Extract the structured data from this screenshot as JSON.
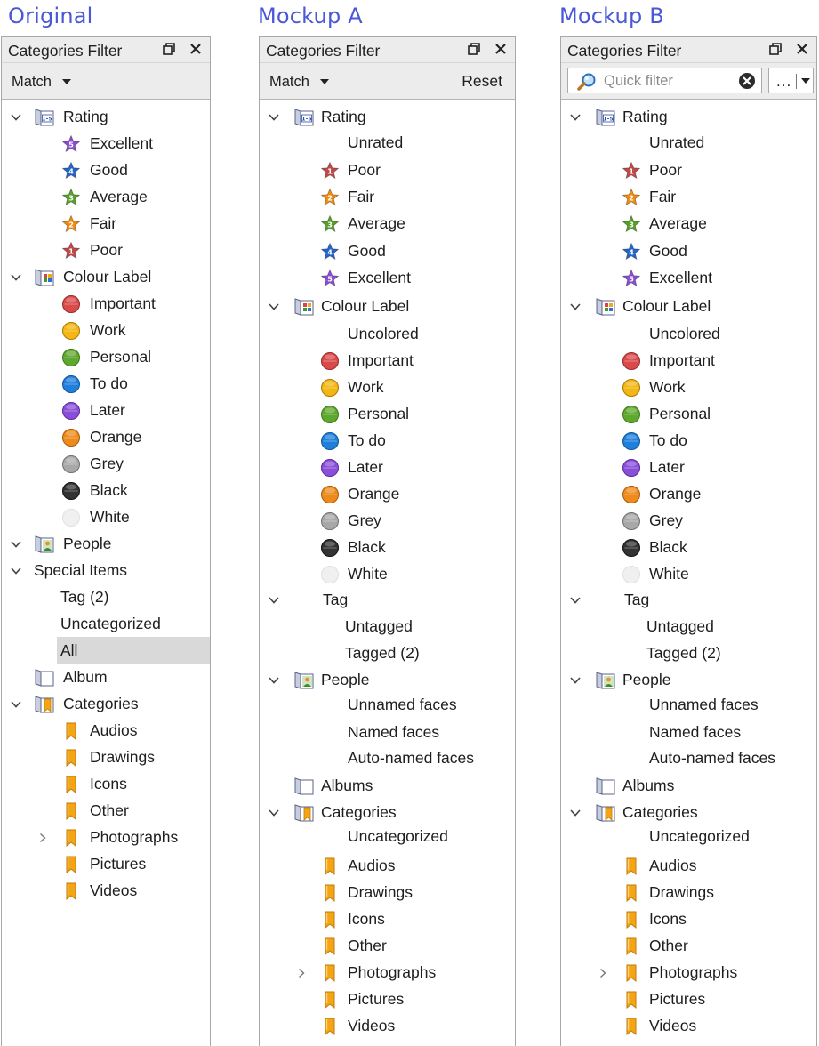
{
  "columns": {
    "original": "Original",
    "mockup_a": "Mockup A",
    "mockup_b": "Mockup B"
  },
  "panel": {
    "title": "Categories Filter",
    "match_label": "Match",
    "reset_label": "Reset",
    "quick_filter_placeholder": "Quick filter",
    "more_label": "..."
  },
  "colors": {
    "title_blue": "#4a57d6",
    "panel_border": "#a8a8a8",
    "toolbar_bg": "#ececec",
    "selection_bg": "#d9d9d9",
    "star_excellent": "#8a4fd0",
    "star_good": "#2466c8",
    "star_average": "#57a12a",
    "star_fair": "#f08c10",
    "star_poor": "#c04a4a",
    "label_important": "#d94a4a",
    "label_work": "#f3b612",
    "label_personal": "#5fa82e",
    "label_todo": "#1f7fdb",
    "label_later": "#8a4fd8",
    "label_orange": "#ee8a1c",
    "label_grey": "#a8a8a8",
    "label_black": "#333333",
    "label_white": "#f0f0f0"
  },
  "original": {
    "tree": [
      {
        "depth": 0,
        "exp": "down",
        "icon": "rating-icon",
        "label": "Rating"
      },
      {
        "depth": 1,
        "icon": "star-excellent-icon",
        "label": "Excellent"
      },
      {
        "depth": 1,
        "icon": "star-good-icon",
        "label": "Good"
      },
      {
        "depth": 1,
        "icon": "star-average-icon",
        "label": "Average"
      },
      {
        "depth": 1,
        "icon": "star-fair-icon",
        "label": "Fair"
      },
      {
        "depth": 1,
        "icon": "star-poor-icon",
        "label": "Poor"
      },
      {
        "depth": 0,
        "exp": "down",
        "icon": "colour-label-icon",
        "label": "Colour Label"
      },
      {
        "depth": 1,
        "icon": "label-important-icon",
        "label": "Important"
      },
      {
        "depth": 1,
        "icon": "label-work-icon",
        "label": "Work"
      },
      {
        "depth": 1,
        "icon": "label-personal-icon",
        "label": "Personal"
      },
      {
        "depth": 1,
        "icon": "label-todo-icon",
        "label": "To do"
      },
      {
        "depth": 1,
        "icon": "label-later-icon",
        "label": "Later"
      },
      {
        "depth": 1,
        "icon": "label-orange-icon",
        "label": "Orange"
      },
      {
        "depth": 1,
        "icon": "label-grey-icon",
        "label": "Grey"
      },
      {
        "depth": 1,
        "icon": "label-black-icon",
        "label": "Black"
      },
      {
        "depth": 1,
        "icon": "label-white-icon",
        "label": "White"
      },
      {
        "depth": 0,
        "exp": "down",
        "icon": "people-icon",
        "label": "People"
      },
      {
        "depth": 0,
        "exp": "down",
        "label": "Special Items"
      },
      {
        "depth": 1,
        "label": "Tag (2)"
      },
      {
        "depth": 1,
        "label": "Uncategorized"
      },
      {
        "depth": 1,
        "label": "All",
        "selected": true
      },
      {
        "depth": 0,
        "icon": "album-icon",
        "label": "Album"
      },
      {
        "depth": 0,
        "exp": "down",
        "icon": "categories-icon",
        "label": "Categories"
      },
      {
        "depth": 1,
        "icon": "bookmark-icon",
        "label": "Audios"
      },
      {
        "depth": 1,
        "icon": "bookmark-icon",
        "label": "Drawings"
      },
      {
        "depth": 1,
        "icon": "bookmark-icon",
        "label": "Icons"
      },
      {
        "depth": 1,
        "icon": "bookmark-icon",
        "label": "Other"
      },
      {
        "depth": 1,
        "exp": "right",
        "icon": "bookmark-icon",
        "label": "Photographs"
      },
      {
        "depth": 1,
        "icon": "bookmark-icon",
        "label": "Pictures"
      },
      {
        "depth": 1,
        "icon": "bookmark-icon",
        "label": "Videos"
      }
    ]
  },
  "mockup_a": {
    "tree": [
      {
        "depth": 0,
        "exp": "down",
        "icon": "rating-icon",
        "label": "Rating"
      },
      {
        "depth": 1,
        "label": "Unrated"
      },
      {
        "depth": 1,
        "icon": "star-poor-icon",
        "label": "Poor"
      },
      {
        "depth": 1,
        "icon": "star-fair-icon",
        "label": "Fair"
      },
      {
        "depth": 1,
        "icon": "star-average-icon",
        "label": "Average"
      },
      {
        "depth": 1,
        "icon": "star-good-icon",
        "label": "Good"
      },
      {
        "depth": 1,
        "icon": "star-excellent-icon",
        "label": "Excellent"
      },
      {
        "depth": 0,
        "exp": "down",
        "icon": "colour-label-icon",
        "label": "Colour Label"
      },
      {
        "depth": 1,
        "label": "Uncolored"
      },
      {
        "depth": 1,
        "icon": "label-important-icon",
        "label": "Important"
      },
      {
        "depth": 1,
        "icon": "label-work-icon",
        "label": "Work"
      },
      {
        "depth": 1,
        "icon": "label-personal-icon",
        "label": "Personal"
      },
      {
        "depth": 1,
        "icon": "label-todo-icon",
        "label": "To do"
      },
      {
        "depth": 1,
        "icon": "label-later-icon",
        "label": "Later"
      },
      {
        "depth": 1,
        "icon": "label-orange-icon",
        "label": "Orange"
      },
      {
        "depth": 1,
        "icon": "label-grey-icon",
        "label": "Grey"
      },
      {
        "depth": 1,
        "icon": "label-black-icon",
        "label": "Black"
      },
      {
        "depth": 1,
        "icon": "label-white-icon",
        "label": "White"
      },
      {
        "depth": 0,
        "exp": "down",
        "label": "Tag",
        "indent_label": true
      },
      {
        "depth": 1,
        "label": "Untagged",
        "indent_label": true
      },
      {
        "depth": 1,
        "label": "Tagged (2)",
        "indent_label": true
      },
      {
        "depth": 0,
        "exp": "down",
        "icon": "people-icon",
        "label": "People"
      },
      {
        "depth": 1,
        "label": "Unnamed faces"
      },
      {
        "depth": 1,
        "label": "Named faces"
      },
      {
        "depth": 1,
        "label": "Auto-named faces"
      },
      {
        "depth": 0,
        "icon": "album-icon",
        "label": "Albums"
      },
      {
        "depth": 0,
        "exp": "down",
        "icon": "categories-icon",
        "label": "Categories"
      },
      {
        "depth": 1,
        "label": "Uncategorized"
      },
      {
        "depth": 1,
        "icon": "bookmark-icon",
        "label": "Audios"
      },
      {
        "depth": 1,
        "icon": "bookmark-icon",
        "label": "Drawings"
      },
      {
        "depth": 1,
        "icon": "bookmark-icon",
        "label": "Icons"
      },
      {
        "depth": 1,
        "icon": "bookmark-icon",
        "label": "Other"
      },
      {
        "depth": 1,
        "exp": "right",
        "icon": "bookmark-icon",
        "label": "Photographs"
      },
      {
        "depth": 1,
        "icon": "bookmark-icon",
        "label": "Pictures"
      },
      {
        "depth": 1,
        "icon": "bookmark-icon",
        "label": "Videos"
      }
    ]
  }
}
